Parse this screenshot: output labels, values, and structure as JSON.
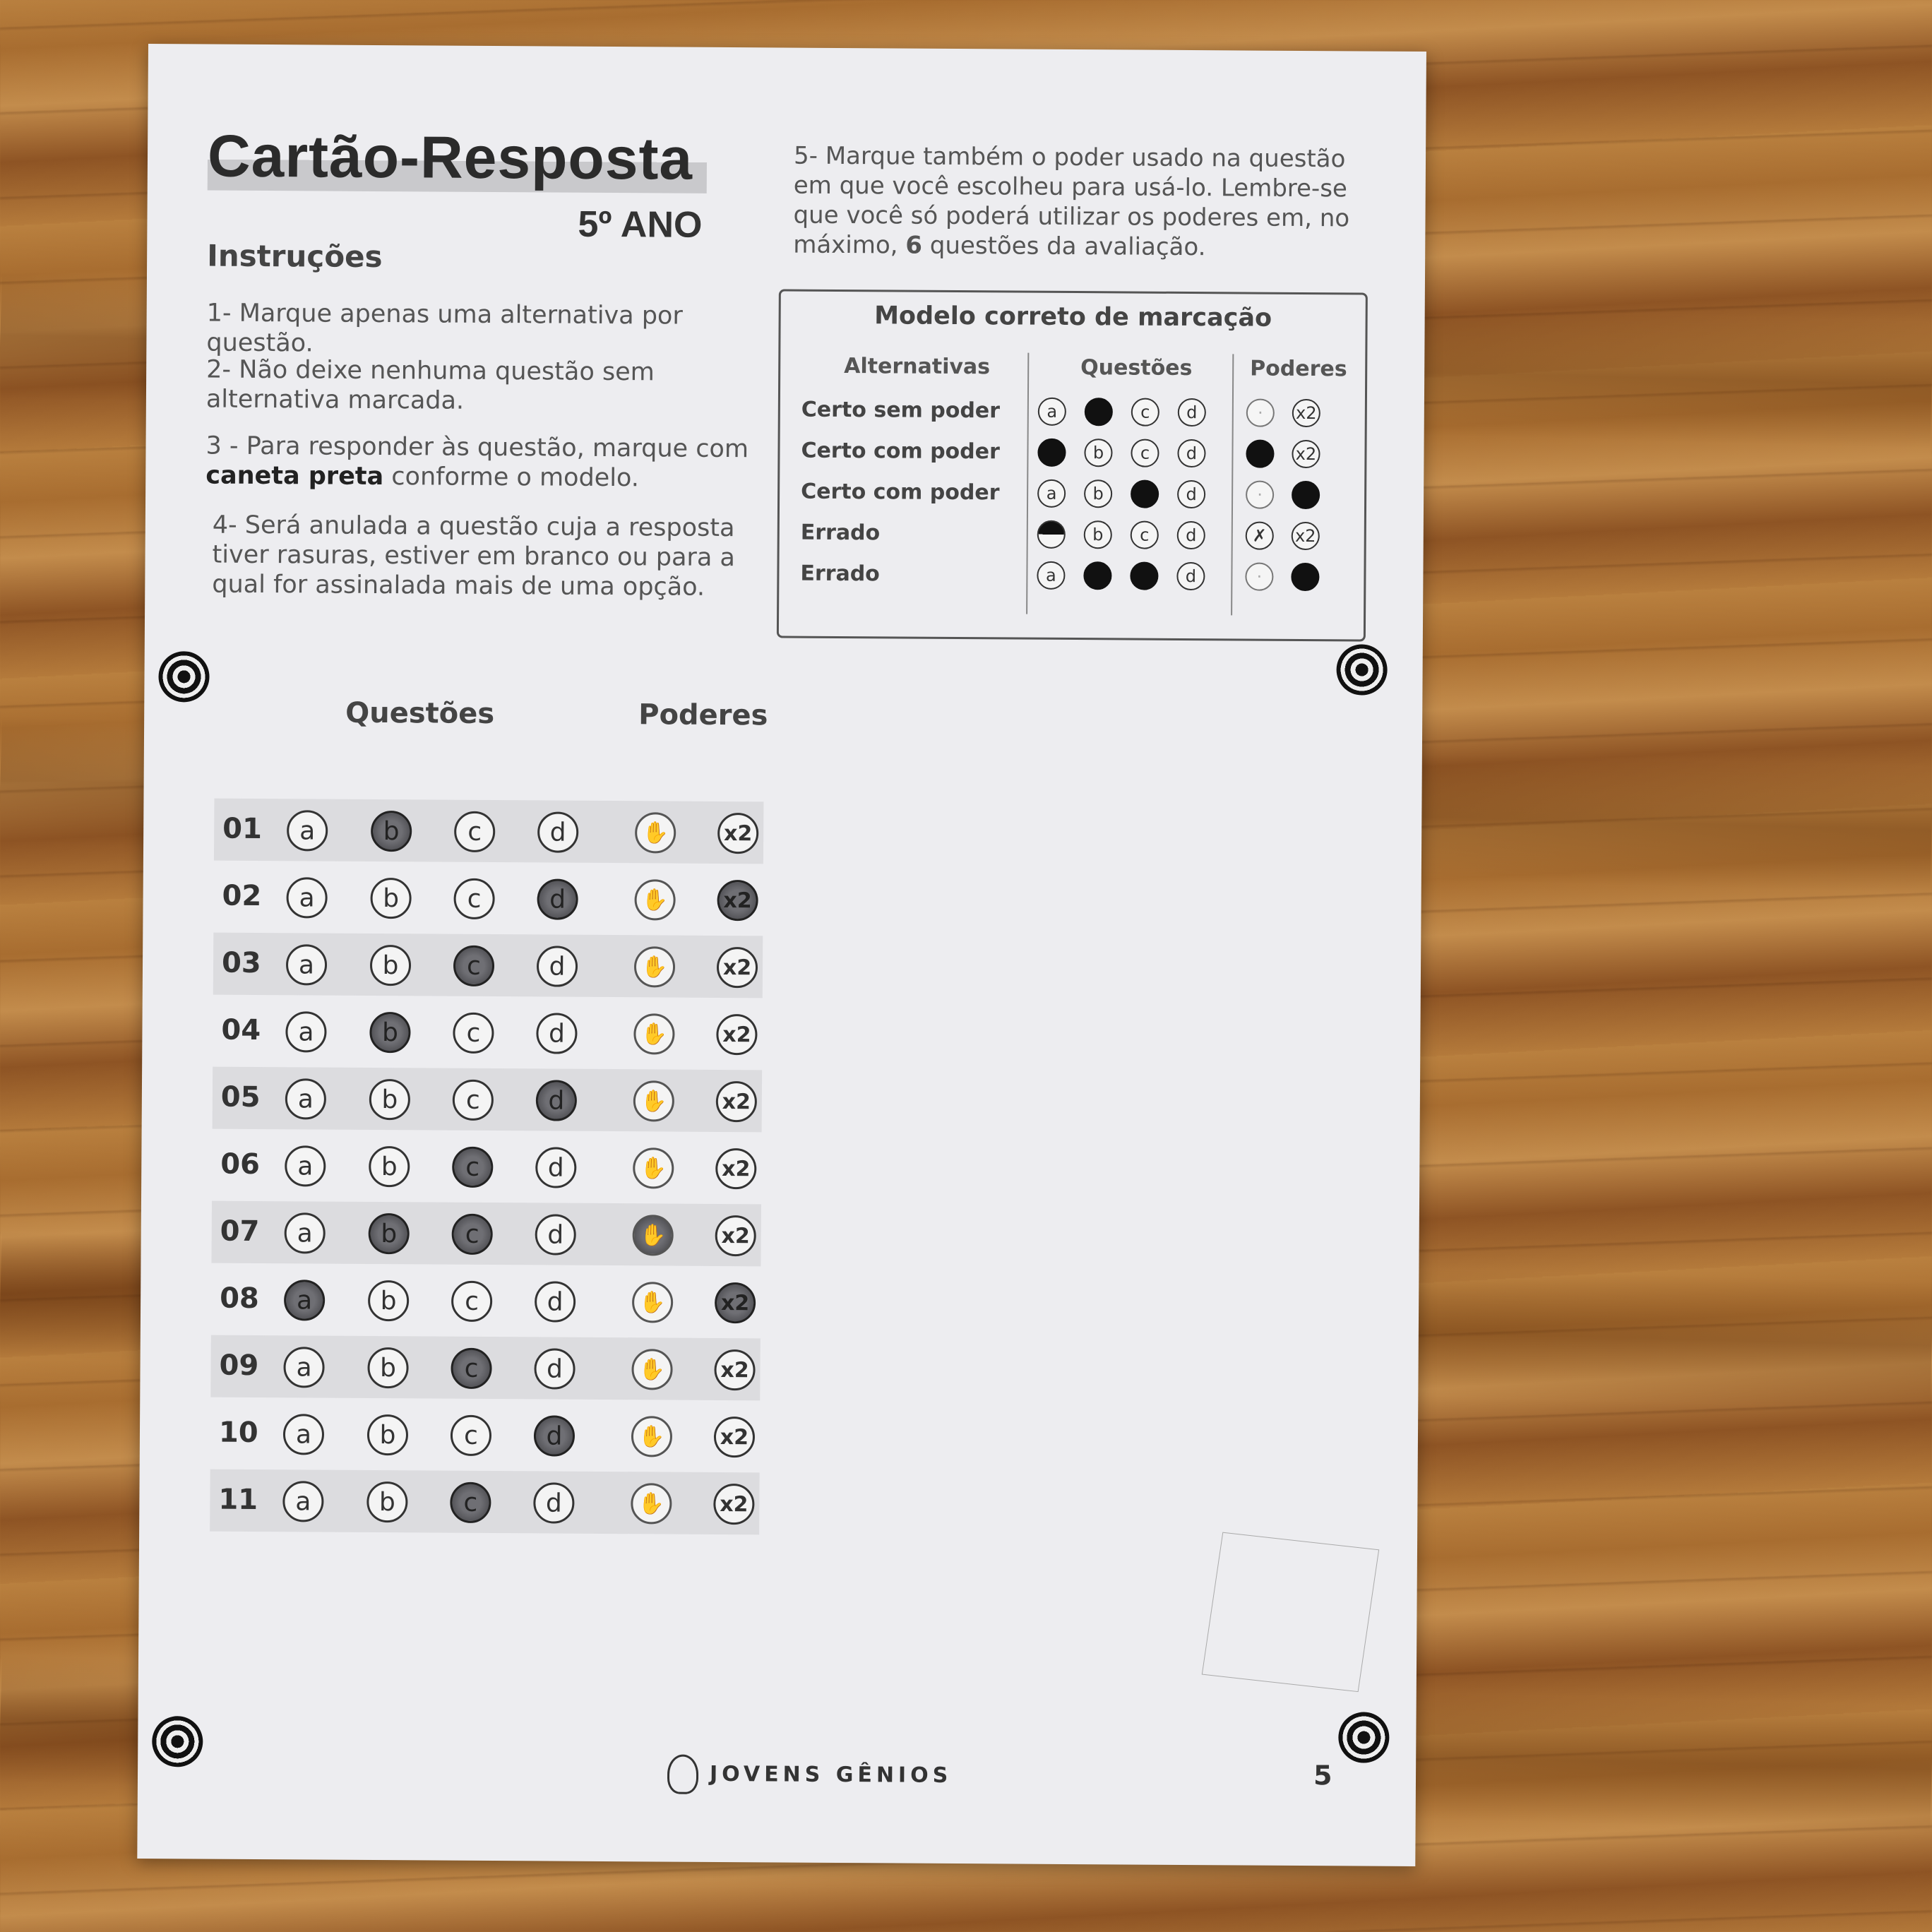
{
  "title": "Cartão-Resposta",
  "grade": "5º ANO",
  "instructions_heading": "Instruções",
  "instructions": {
    "i1": "1- Marque apenas uma alternativa por questão.",
    "i2": "2- Não deixe nenhuma questão sem alternativa marcada.",
    "i3_pre": "3 - Para responder às questão, marque com",
    "i3_bold": "caneta preta",
    "i3_post": "conforme o modelo.",
    "i4": "4- Será anulada a questão cuja a resposta tiver rasuras, estiver em branco ou para a qual for assinalada mais de uma opção.",
    "i5_pre": "5-  Marque também o poder usado na questão em que você escolheu para usá-lo. Lembre-se que você só poderá utilizar os poderes em, no máximo,",
    "i5_bold": "6",
    "i5_post": "questões da avaliação."
  },
  "model": {
    "title": "Modelo correto de marcação",
    "col_alt": "Alternativas",
    "col_q": "Questões",
    "col_p": "Poderes",
    "rows": [
      {
        "label": "Certo sem poder",
        "q": [
          "a",
          "●",
          "c",
          "d"
        ],
        "p": [
          "·",
          "x2"
        ]
      },
      {
        "label": "Certo com poder",
        "q": [
          "●",
          "b",
          "c",
          "d"
        ],
        "p": [
          "●",
          "x2"
        ]
      },
      {
        "label": "Certo com poder",
        "q": [
          "a",
          "b",
          "●",
          "d"
        ],
        "p": [
          "·",
          "●"
        ]
      },
      {
        "label": "Errado",
        "q": [
          "◐",
          "b",
          "c",
          "d"
        ],
        "p": [
          "✗",
          "x2"
        ]
      },
      {
        "label": "Errado",
        "q": [
          "a",
          "●",
          "●",
          "d"
        ],
        "p": [
          "·",
          "●"
        ]
      }
    ]
  },
  "sheet": {
    "col_q": "Questões",
    "col_p": "Poderes",
    "power_label": "x2",
    "rows": [
      {
        "n": "01",
        "marked": [
          "b"
        ],
        "pw": [
          false,
          false
        ]
      },
      {
        "n": "02",
        "marked": [
          "d"
        ],
        "pw": [
          false,
          true
        ]
      },
      {
        "n": "03",
        "marked": [
          "c"
        ],
        "pw": [
          false,
          false
        ]
      },
      {
        "n": "04",
        "marked": [
          "b"
        ],
        "pw": [
          false,
          false
        ]
      },
      {
        "n": "05",
        "marked": [
          "d"
        ],
        "pw": [
          false,
          false
        ]
      },
      {
        "n": "06",
        "marked": [
          "c"
        ],
        "pw": [
          false,
          false
        ]
      },
      {
        "n": "07",
        "marked": [
          "b",
          "c"
        ],
        "pw": [
          true,
          false
        ]
      },
      {
        "n": "08",
        "marked": [
          "a"
        ],
        "pw": [
          false,
          true
        ]
      },
      {
        "n": "09",
        "marked": [
          "c"
        ],
        "pw": [
          false,
          false
        ]
      },
      {
        "n": "10",
        "marked": [
          "d"
        ],
        "pw": [
          false,
          false
        ]
      },
      {
        "n": "11",
        "marked": [
          "c"
        ],
        "pw": [
          false,
          false
        ]
      }
    ]
  },
  "footer": {
    "brand": "JOVENS GÊNIOS",
    "page": "5"
  }
}
